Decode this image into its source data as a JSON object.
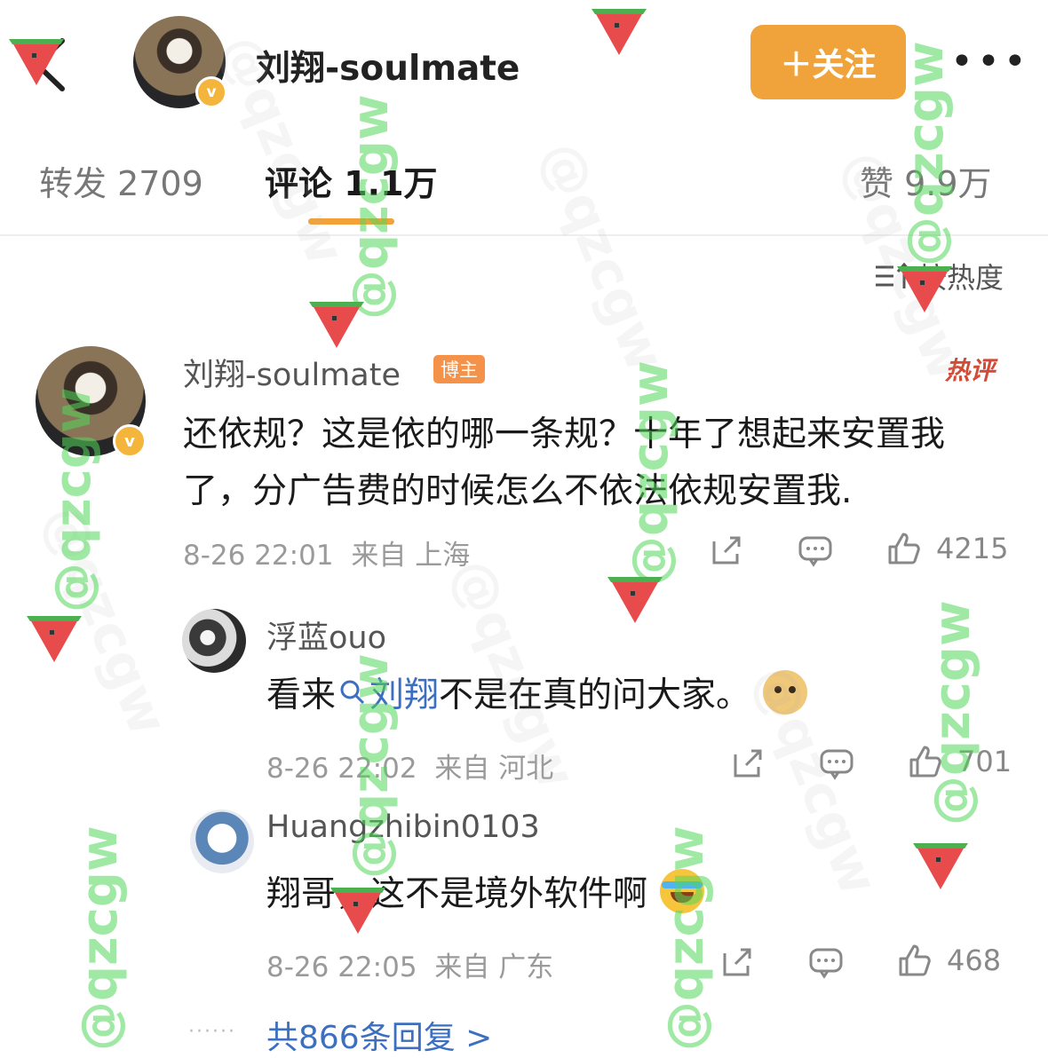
{
  "header": {
    "account_name": "刘翔-soulmate",
    "follow_label": "＋关注",
    "more_label": "•••"
  },
  "tabs": [
    {
      "label": "转发 2709"
    },
    {
      "label": "评论 1.1万"
    },
    {
      "label": "赞 9.9万"
    }
  ],
  "sort": {
    "label": "按热度"
  },
  "comment": {
    "author": "刘翔-soulmate",
    "badge": "博主",
    "hot_label": "热评",
    "text": "还依规？这是依的哪一条规？十年了想起来安置我了，分广告费的时候怎么不依法依规安置我.",
    "time": "8-26 22:01",
    "location": "来自 上海",
    "likes": "4215"
  },
  "replies": [
    {
      "author": "浮蓝ouo",
      "text_before": "看来",
      "mention": "刘翔",
      "text_after": "不是在真的问大家。",
      "emoji": "doge-emoji",
      "time": "8-26 22:02",
      "location": "来自 河北",
      "likes": "701"
    },
    {
      "author": "Huangzhibin0103",
      "text": "翔哥，这不是境外软件啊",
      "emoji": "laughing-crying-emoji",
      "time": "8-26 22:05",
      "location": "来自 广东",
      "likes": "468"
    }
  ],
  "more_replies": {
    "dots": "······",
    "label": "共866条回复 >"
  },
  "watermark": {
    "text": "@qzcgw"
  },
  "colors": {
    "accent": "#f3a23a",
    "follow": "#f0a33a",
    "mention": "#3c6fc0",
    "watermark": "#50d75a"
  }
}
